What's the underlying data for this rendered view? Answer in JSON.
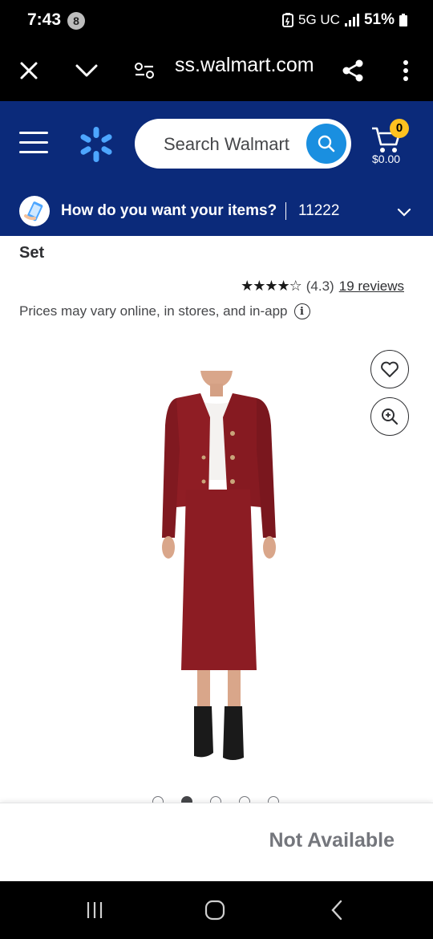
{
  "status_bar": {
    "time": "7:43",
    "notification_count": "8",
    "network": "5G UC",
    "battery": "51%"
  },
  "browser": {
    "url": "ss.walmart.com",
    "icons": [
      "close-icon",
      "chevron-down-icon",
      "site-settings-icon",
      "share-icon",
      "more-vert-icon"
    ]
  },
  "header": {
    "search_placeholder": "Search Walmart",
    "cart_count": "0",
    "cart_total": "$0.00",
    "brand_color": "#0b2a7a",
    "accent_color": "#ffc220",
    "delivery_question": "How do you want your items?",
    "zip_code": "11222"
  },
  "product": {
    "title_tail": "Set",
    "rating": 4.3,
    "rating_text": "(4.3)",
    "reviews_link": "19 reviews",
    "price_note": "Prices may vary online, in stores, and in-app",
    "image_count": 5,
    "active_image_index": 1,
    "availability": "Not Available"
  }
}
